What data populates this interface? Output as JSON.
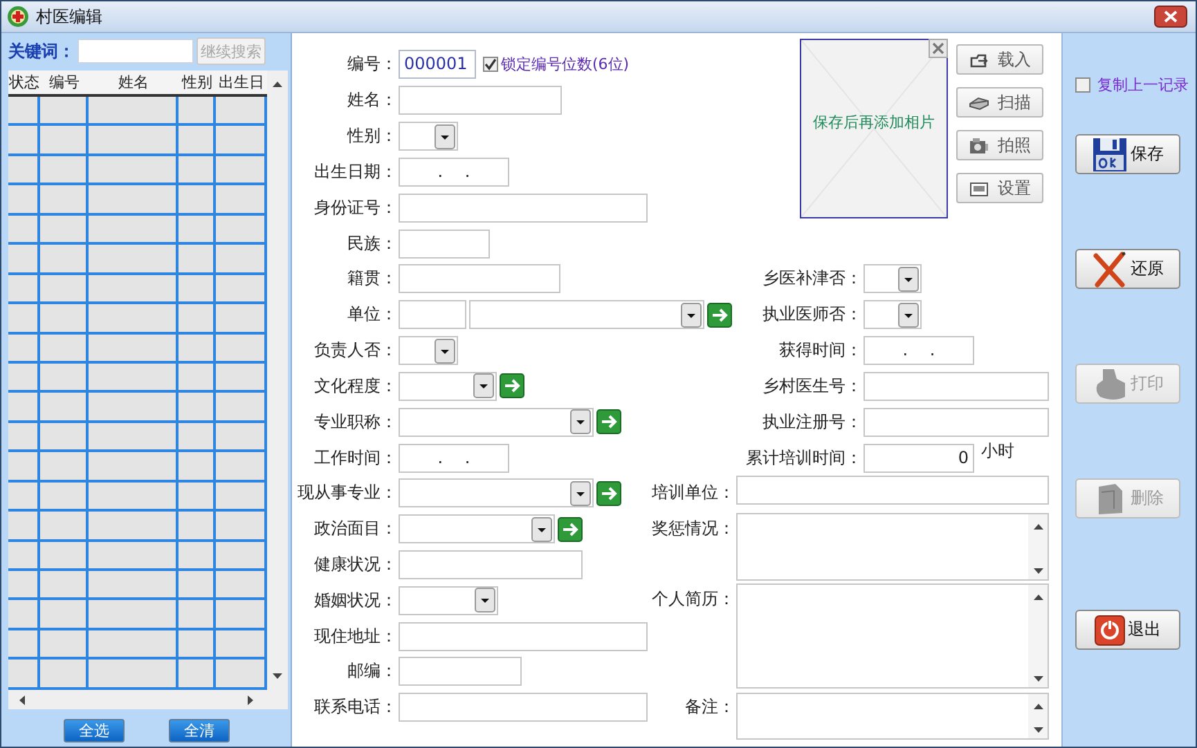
{
  "window": {
    "title": "村医编辑"
  },
  "search": {
    "label": "关键词：",
    "button": {
      "label": "继续搜索",
      "disabled": true
    }
  },
  "table": {
    "columns": [
      "状态",
      "编号",
      "姓名",
      "性别",
      "出生日"
    ]
  },
  "list_buttons": [
    {
      "label": "全选"
    },
    {
      "label": "全清"
    }
  ],
  "form_left": [
    {
      "label": "编号：",
      "kind": "code",
      "value": "000001",
      "lock": {
        "label": "锁定编号位数(6位)",
        "checked": true
      }
    },
    {
      "label": "姓名：",
      "kind": "text"
    },
    {
      "label": "性别：",
      "kind": "combo"
    },
    {
      "label": "出生日期：",
      "kind": "date",
      "value": ". ."
    },
    {
      "label": "身份证号：",
      "kind": "text"
    },
    {
      "label": "民族：",
      "kind": "text"
    },
    {
      "label": "籍贯：",
      "kind": "text"
    },
    {
      "label": "单位：",
      "kind": "unit"
    },
    {
      "label": "负责人否：",
      "kind": "combo"
    },
    {
      "label": "文化程度：",
      "kind": "combo_go"
    },
    {
      "label": "专业职称：",
      "kind": "combo_go"
    },
    {
      "label": "工作时间：",
      "kind": "date",
      "value": ". ."
    },
    {
      "label": "现从事专业：",
      "kind": "combo_go"
    },
    {
      "label": "政治面目：",
      "kind": "combo_go"
    },
    {
      "label": "健康状况：",
      "kind": "text"
    },
    {
      "label": "婚姻状况：",
      "kind": "combo"
    },
    {
      "label": "现住地址：",
      "kind": "text"
    },
    {
      "label": "邮编：",
      "kind": "text"
    },
    {
      "label": "联系电话：",
      "kind": "text"
    }
  ],
  "photo": {
    "caption": "保存后再添加相片",
    "buttons": [
      {
        "label": "载入",
        "kind": "load"
      },
      {
        "label": "扫描",
        "kind": "scan"
      },
      {
        "label": "拍照",
        "kind": "camera"
      },
      {
        "label": "设置",
        "kind": "settings"
      }
    ]
  },
  "form_right": [
    {
      "label": "乡医补津否：",
      "kind": "combo"
    },
    {
      "label": "执业医师否：",
      "kind": "combo"
    },
    {
      "label": "获得时间：",
      "kind": "date",
      "value": ". ."
    },
    {
      "label": "乡村医生号：",
      "kind": "text"
    },
    {
      "label": "执业注册号：",
      "kind": "text"
    },
    {
      "label": "累计培训时间：",
      "kind": "number",
      "value": "0",
      "unit": "小时"
    },
    {
      "label": "培训单位：",
      "kind": "wide"
    },
    {
      "label": "奖惩情况：",
      "kind": "textarea"
    },
    {
      "label": "个人简历：",
      "kind": "textarea"
    },
    {
      "label": "备注：",
      "kind": "textarea"
    }
  ],
  "copy_previous": {
    "label": "复制上一记录",
    "checked": false
  },
  "actions": [
    {
      "label": "保存",
      "kind": "save",
      "disabled": false
    },
    {
      "label": "还原",
      "kind": "undo",
      "disabled": false
    },
    {
      "label": "打印",
      "kind": "print",
      "disabled": true
    },
    {
      "label": "删除",
      "kind": "delete",
      "disabled": true
    },
    {
      "label": "退出",
      "kind": "exit",
      "disabled": false
    }
  ]
}
